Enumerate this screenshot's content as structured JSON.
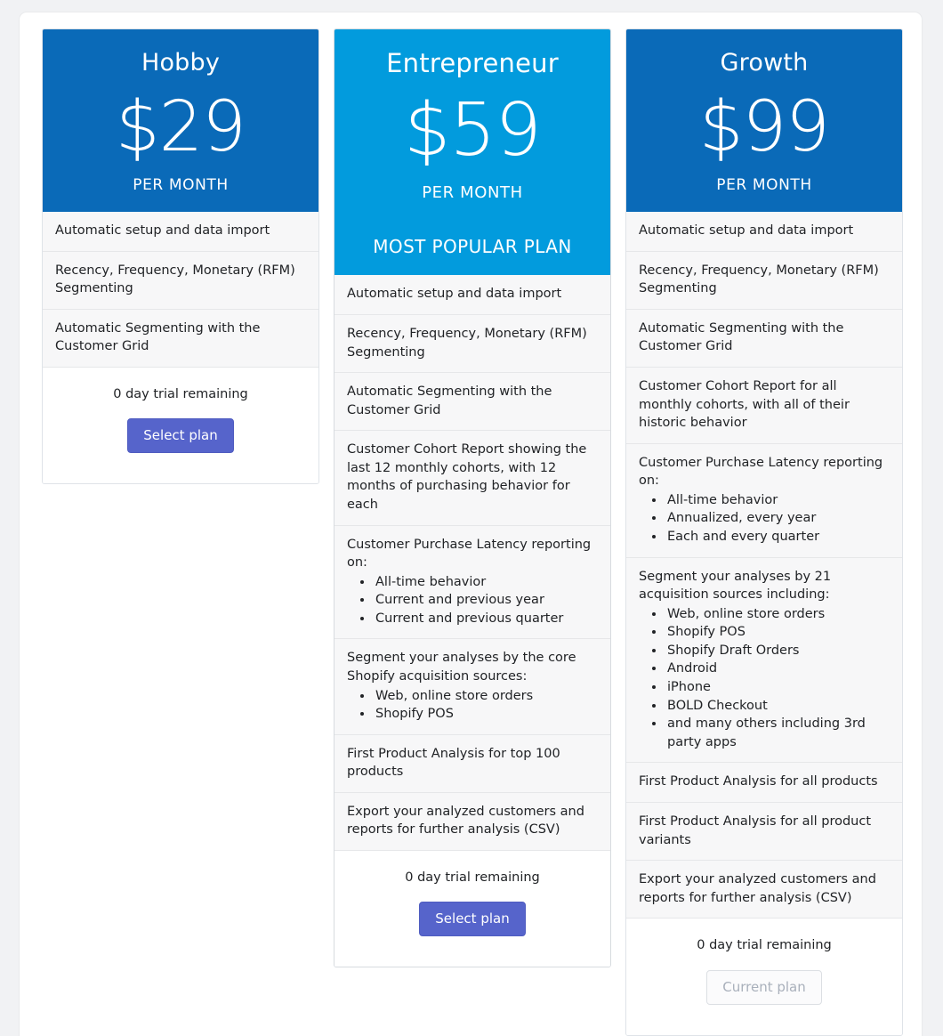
{
  "page": {
    "background_color": "#f1f2f4",
    "panel_color": "#ffffff"
  },
  "colors": {
    "standard_header": "#0a6ab8",
    "featured_header": "#029bdd",
    "primary_button": "#5664cb",
    "disabled_button_text": "#a9b0bb",
    "feature_row_background": "#f7f7f8"
  },
  "plans": [
    {
      "name": "Hobby",
      "price": "$29",
      "period": "PER MONTH",
      "badge": null,
      "featured": false,
      "features": [
        {
          "text": "Automatic setup and data import",
          "items": []
        },
        {
          "text": "Recency, Frequency, Monetary (RFM) Segmenting",
          "items": []
        },
        {
          "text": "Automatic Segmenting with the Customer Grid",
          "items": []
        }
      ],
      "trial": "0 day trial remaining",
      "button": {
        "label": "Select plan",
        "state": "primary"
      }
    },
    {
      "name": "Entrepreneur",
      "price": "$59",
      "period": "PER MONTH",
      "badge": "MOST POPULAR PLAN",
      "featured": true,
      "features": [
        {
          "text": "Automatic setup and data import",
          "items": []
        },
        {
          "text": "Recency, Frequency, Monetary (RFM) Segmenting",
          "items": []
        },
        {
          "text": "Automatic Segmenting with the Customer Grid",
          "items": []
        },
        {
          "text": "Customer Cohort Report showing the last 12 monthly cohorts, with 12 months of purchasing behavior for each",
          "items": []
        },
        {
          "text": "Customer Purchase Latency reporting on:",
          "items": [
            "All-time behavior",
            "Current and previous year",
            "Current and previous quarter"
          ]
        },
        {
          "text": "Segment your analyses by the core Shopify acquisition sources:",
          "items": [
            "Web, online store orders",
            "Shopify POS"
          ]
        },
        {
          "text": "First Product Analysis for top 100 products",
          "items": []
        },
        {
          "text": "Export your analyzed customers and reports for further analysis (CSV)",
          "items": []
        }
      ],
      "trial": "0 day trial remaining",
      "button": {
        "label": "Select plan",
        "state": "primary"
      }
    },
    {
      "name": "Growth",
      "price": "$99",
      "period": "PER MONTH",
      "badge": null,
      "featured": false,
      "features": [
        {
          "text": "Automatic setup and data import",
          "items": []
        },
        {
          "text": "Recency, Frequency, Monetary (RFM) Segmenting",
          "items": []
        },
        {
          "text": "Automatic Segmenting with the Customer Grid",
          "items": []
        },
        {
          "text": "Customer Cohort Report for all monthly cohorts, with all of their historic behavior",
          "items": []
        },
        {
          "text": "Customer Purchase Latency reporting on:",
          "items": [
            "All-time behavior",
            "Annualized, every year",
            "Each and every quarter"
          ]
        },
        {
          "text": "Segment your analyses by 21 acquisition sources including:",
          "items": [
            "Web, online store orders",
            "Shopify POS",
            "Shopify Draft Orders",
            "Android",
            "iPhone",
            "BOLD Checkout",
            "and many others including 3rd party apps"
          ]
        },
        {
          "text": "First Product Analysis for all products",
          "items": []
        },
        {
          "text": "First Product Analysis for all product variants",
          "items": []
        },
        {
          "text": "Export your analyzed customers and reports for further analysis (CSV)",
          "items": []
        }
      ],
      "trial": "0 day trial remaining",
      "button": {
        "label": "Current plan",
        "state": "disabled"
      }
    }
  ]
}
